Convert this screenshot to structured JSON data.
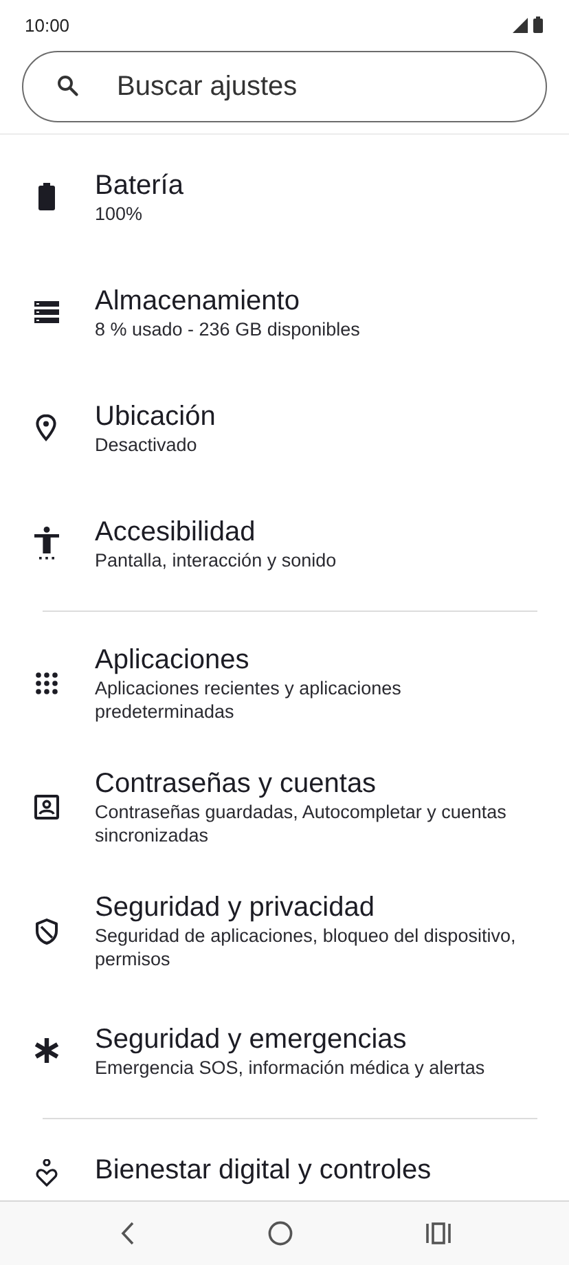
{
  "status_bar": {
    "time": "10:00"
  },
  "search": {
    "placeholder": "Buscar ajustes"
  },
  "sections": [
    {
      "items": [
        {
          "title": "Batería",
          "subtitle": "100%"
        },
        {
          "title": "Almacenamiento",
          "subtitle": "8 % usado - 236 GB disponibles"
        },
        {
          "title": "Ubicación",
          "subtitle": "Desactivado"
        },
        {
          "title": "Accesibilidad",
          "subtitle": "Pantalla, interacción y sonido"
        }
      ]
    },
    {
      "items": [
        {
          "title": "Aplicaciones",
          "subtitle": "Aplicaciones recientes y aplicaciones predeterminadas"
        },
        {
          "title": "Contraseñas y cuentas",
          "subtitle": "Contraseñas guardadas, Autocompletar y cuentas sincronizadas"
        },
        {
          "title": "Seguridad y privacidad",
          "subtitle": "Seguridad de aplicaciones, bloqueo del dispositivo, permisos"
        },
        {
          "title": "Seguridad y emergencias",
          "subtitle": "Emergencia SOS, información médica y alertas"
        }
      ]
    },
    {
      "items": [
        {
          "title": "Bienestar digital y controles"
        }
      ]
    }
  ]
}
